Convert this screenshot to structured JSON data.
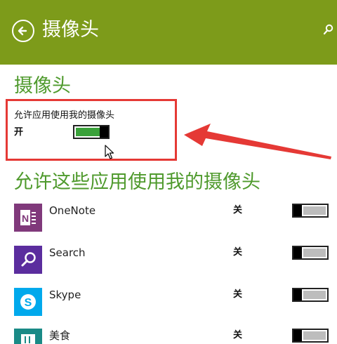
{
  "header": {
    "title": "摄像头",
    "back_icon": "back-arrow-icon",
    "search_icon": "search-icon",
    "bg_color": "#7d9b1a"
  },
  "section": {
    "title": "摄像头",
    "setting_label": "允许应用使用我的摄像头",
    "setting_state": "开",
    "setting_on": true
  },
  "apps": {
    "title": "允许这些应用使用我的摄像头",
    "items": [
      {
        "name": "OneNote",
        "state": "关",
        "on": false,
        "icon": "onenote-icon",
        "color": "#80397b"
      },
      {
        "name": "Search",
        "state": "关",
        "on": false,
        "icon": "search-app-icon",
        "color": "#5b2d9e"
      },
      {
        "name": "Skype",
        "state": "关",
        "on": false,
        "icon": "skype-icon",
        "color": "#00a9ec"
      },
      {
        "name": "美食",
        "state": "关",
        "on": false,
        "icon": "food-icon",
        "color": "#1a8a86"
      }
    ]
  },
  "colors": {
    "accent_green": "#4f9a2d",
    "toggle_on": "#3aa13a",
    "annotation_red": "#e53935"
  }
}
